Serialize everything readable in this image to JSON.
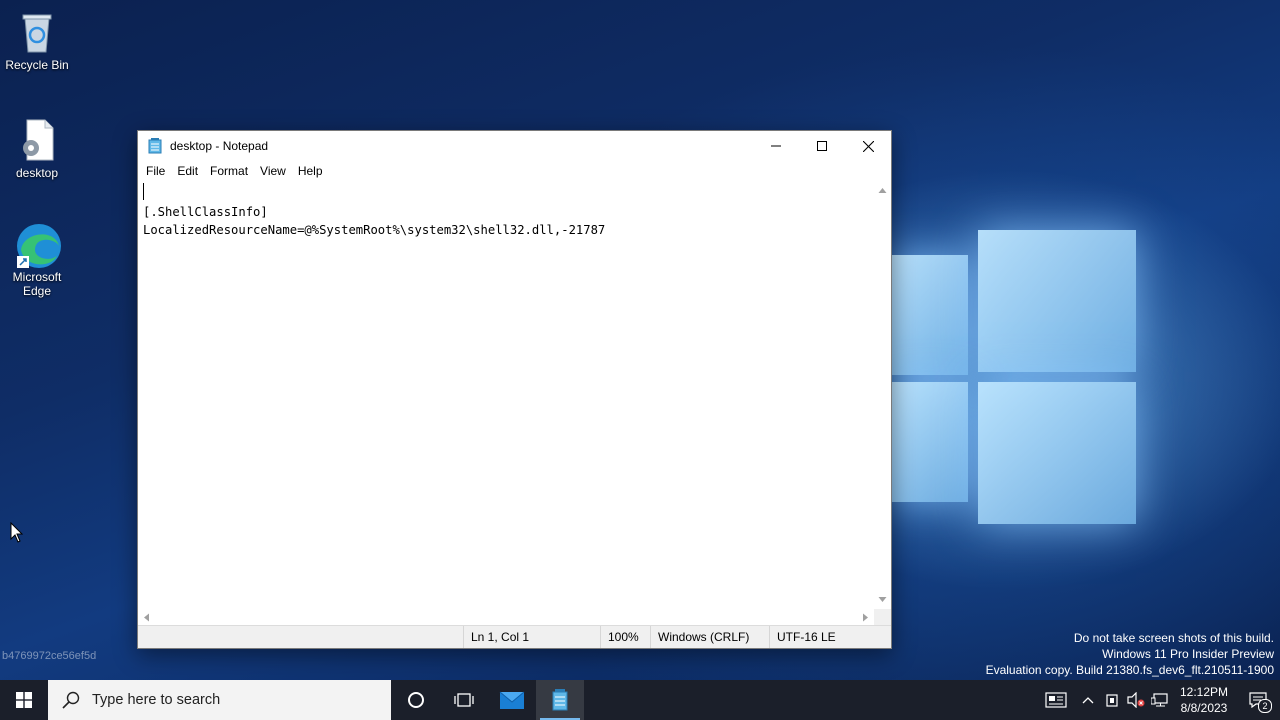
{
  "desktop": {
    "icons": [
      {
        "label": "Recycle Bin"
      },
      {
        "label": "desktop"
      },
      {
        "label": "Microsoft Edge"
      }
    ],
    "build_id": "b4769972ce56ef5d",
    "watermark": {
      "line1": "Do not take screen shots of this build.",
      "line2": "Windows 11 Pro Insider Preview",
      "line3": "Evaluation copy. Build 21380.fs_dev6_flt.210511-1900"
    }
  },
  "notepad": {
    "title": "desktop - Notepad",
    "menu": [
      "File",
      "Edit",
      "Format",
      "View",
      "Help"
    ],
    "content_lines": [
      "",
      "[.ShellClassInfo]",
      "LocalizedResourceName=@%SystemRoot%\\system32\\shell32.dll,-21787"
    ],
    "status": {
      "position": "Ln 1, Col 1",
      "zoom": "100%",
      "line_ending": "Windows (CRLF)",
      "encoding": "UTF-16 LE"
    }
  },
  "taskbar": {
    "search_placeholder": "Type here to search",
    "clock_time": "12:12PM",
    "clock_date": "8/8/2023",
    "notification_count": "2"
  },
  "colors": {
    "taskbar_bg": "#1b1f2a",
    "accent": "#76b9ed"
  }
}
